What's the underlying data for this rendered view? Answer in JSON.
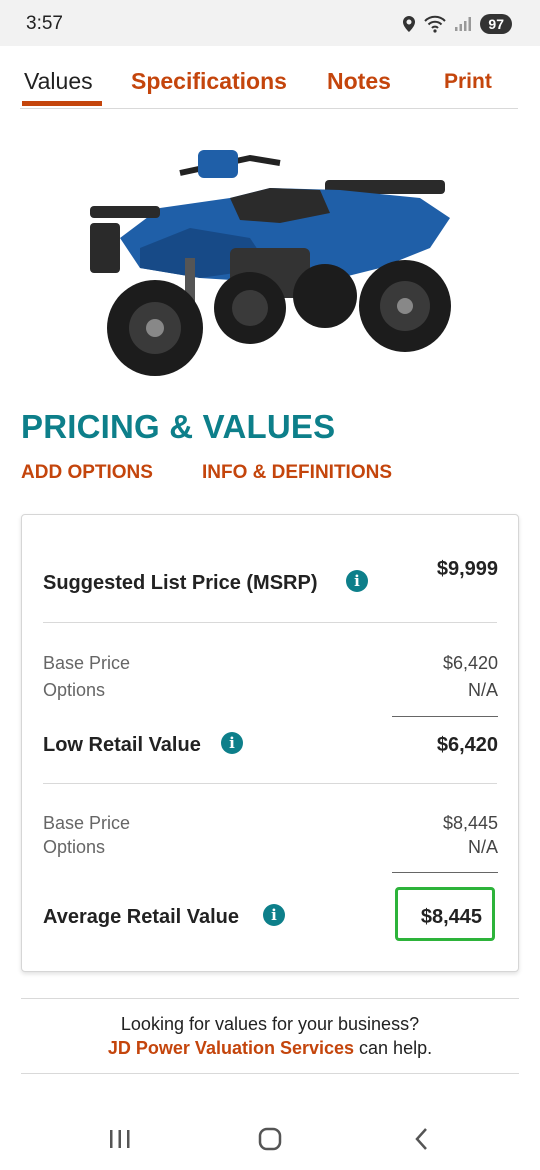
{
  "status_bar": {
    "time": "3:57",
    "battery": "97"
  },
  "tabs": [
    {
      "label": "Values",
      "active": true
    },
    {
      "label": "Specifications"
    },
    {
      "label": "Notes"
    },
    {
      "label": "Print"
    }
  ],
  "section": {
    "heading": "PRICING & VALUES",
    "add_options": "ADD OPTIONS",
    "info_definitions": "INFO & DEFINITIONS"
  },
  "card": {
    "msrp": {
      "label": "Suggested List Price (MSRP)",
      "value": "$9,999"
    },
    "low": {
      "base_label": "Base Price",
      "base_value": "$6,420",
      "options_label": "Options",
      "options_value": "N/A",
      "label": "Low Retail Value",
      "value": "$6,420"
    },
    "average": {
      "base_label": "Base Price",
      "base_value": "$8,445",
      "options_label": "Options",
      "options_value": "N/A",
      "label": "Average Retail Value",
      "value": "$8,445"
    }
  },
  "promo": {
    "line1": "Looking for values for your business?",
    "link": "JD Power Valuation Services",
    "suffix": " can help."
  },
  "colors": {
    "accent": "#c4450c",
    "teal": "#0d7f8a",
    "highlight": "#2db33a"
  },
  "icons": [
    "location-icon",
    "wifi-icon",
    "signal-icon",
    "info-icon",
    "recent-apps-icon",
    "home-icon",
    "back-icon"
  ]
}
